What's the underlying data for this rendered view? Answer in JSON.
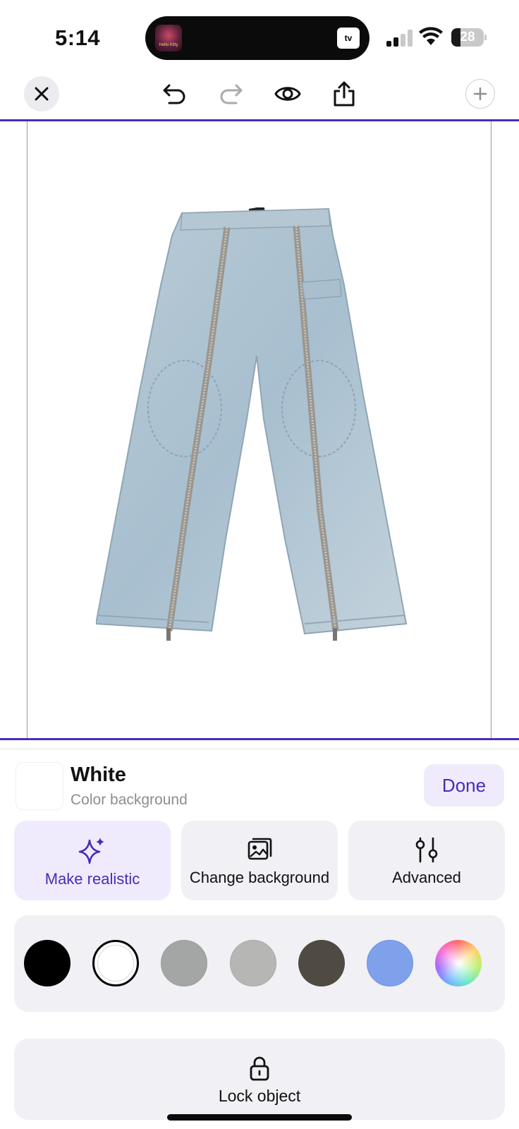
{
  "status_bar": {
    "time": "5:14",
    "island_app_name": "Hello Kitty",
    "island_right": "tv",
    "battery_level": "28",
    "battery_fraction": 0.28
  },
  "toolbar": {
    "close_icon": "close-icon",
    "undo_icon": "undo-icon",
    "redo_icon": "redo-icon",
    "preview_icon": "eye-icon",
    "share_icon": "share-icon",
    "add_icon": "plus-icon"
  },
  "canvas": {
    "subject": "light-wash denim jeans with front zippers",
    "background_color": "#ffffff",
    "frame_color": "#4b2bbf"
  },
  "background_panel": {
    "title": "White",
    "subtitle": "Color background",
    "done_label": "Done"
  },
  "options": [
    {
      "label": "Make realistic",
      "icon": "sparkle-icon",
      "active": true
    },
    {
      "label": "Change background",
      "icon": "images-icon",
      "active": false
    },
    {
      "label": "Advanced",
      "icon": "sliders-icon",
      "active": false
    }
  ],
  "colors": [
    {
      "name": "black",
      "hex": "#000000"
    },
    {
      "name": "white",
      "hex": "#ffffff",
      "selected": true
    },
    {
      "name": "gray",
      "hex": "#a4a6a5"
    },
    {
      "name": "light-gray",
      "hex": "#b6b6b4"
    },
    {
      "name": "dark-gray",
      "hex": "#4f4a42"
    },
    {
      "name": "blue",
      "hex": "#7fa1ec"
    },
    {
      "name": "color-picker",
      "hex": "rainbow"
    }
  ],
  "lock": {
    "label": "Lock object",
    "icon": "lock-icon"
  },
  "accent_color": "#4a2bb8"
}
